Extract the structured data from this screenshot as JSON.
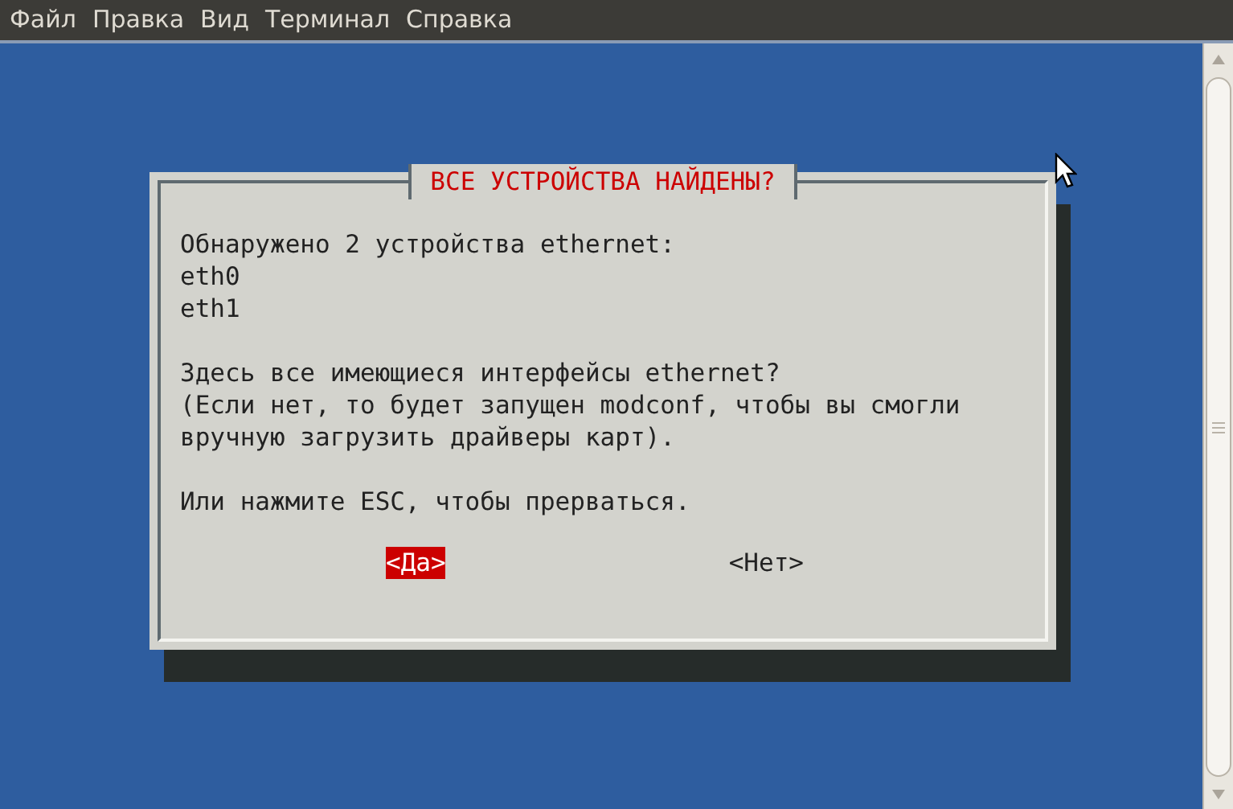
{
  "menu": [
    "Файл",
    "Правка",
    "Вид",
    "Терминал",
    "Справка"
  ],
  "dialog": {
    "title": "ВСЕ УСТРОЙСТВА НАЙДЕНЫ?",
    "paragraphs": [
      [
        "Обнаружено 2 устройства ethernet:",
        "eth0",
        "eth1"
      ],
      [
        "Здесь все имеющиеся интерфейсы ethernet?",
        "(Если нет, то будет запущен modconf, чтобы вы смогли",
        "вручную загрузить драйверы карт)."
      ],
      [
        "Или нажмите ESC, чтобы прерваться."
      ]
    ],
    "buttons": [
      {
        "label": "<Да>",
        "selected": true
      },
      {
        "label": "<Нет>",
        "selected": false
      }
    ]
  }
}
